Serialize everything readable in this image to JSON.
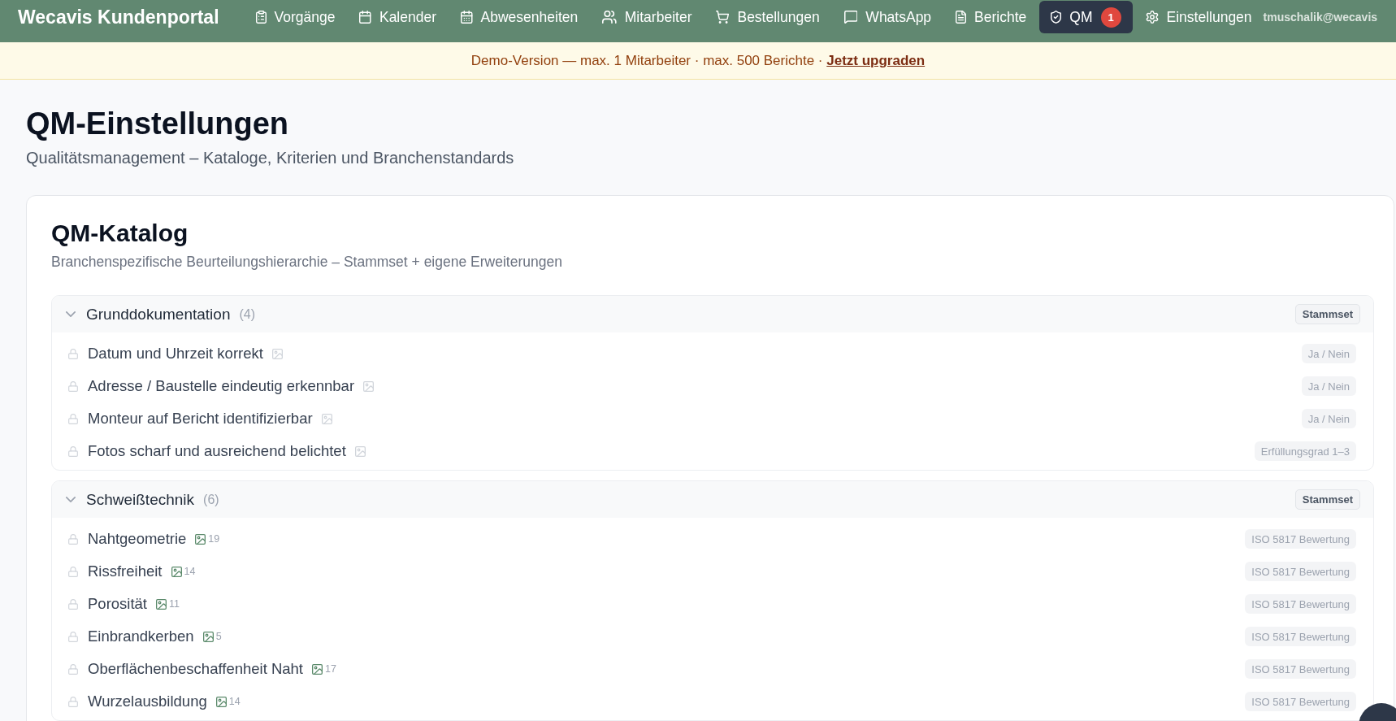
{
  "nav": {
    "brand": "Wecavis Kundenportal",
    "items": [
      {
        "label": "Vorgänge",
        "selected": false
      },
      {
        "label": "Kalender",
        "selected": false
      },
      {
        "label": "Abwesenheiten",
        "selected": false
      },
      {
        "label": "Mitarbeiter",
        "selected": false
      },
      {
        "label": "Bestellungen",
        "selected": false
      },
      {
        "label": "WhatsApp",
        "selected": false
      },
      {
        "label": "Berichte",
        "selected": false
      },
      {
        "label": "QM",
        "selected": true,
        "badge": "1"
      },
      {
        "label": "Einstellungen",
        "selected": false
      }
    ],
    "user": "tmuschalik@wecavis"
  },
  "banner": {
    "text": "Demo-Version — max. 1 Mitarbeiter · max. 500 Berichte ·",
    "link": "Jetzt upgraden"
  },
  "page": {
    "title": "QM-Einstellungen",
    "subtitle": "Qualitätsmanagement – Kataloge, Kriterien und Branchenstandards"
  },
  "catalog": {
    "title": "QM-Katalog",
    "subtitle": "Branchenspezifische Beurteilungshierarchie – Stammset + eigene Erweiterungen",
    "sections": [
      {
        "title": "Grunddokumentation",
        "count": "(4)",
        "expanded": true,
        "badge": "Stammset",
        "criteria": [
          {
            "label": "Datum und Uhrzeit korrekt",
            "locked": true,
            "rating_type": "Ja / Nein"
          },
          {
            "label": "Adresse / Baustelle eindeutig erkennbar",
            "locked": true,
            "rating_type": "Ja / Nein"
          },
          {
            "label": "Monteur auf Bericht identifizierbar",
            "locked": true,
            "rating_type": "Ja / Nein"
          },
          {
            "label": "Fotos scharf und ausreichend belichtet",
            "locked": true,
            "rating_type": "Erfüllungsgrad 1–3"
          }
        ]
      },
      {
        "title": "Schweißtechnik",
        "count": "(6)",
        "expanded": true,
        "badge": "Stammset",
        "criteria": [
          {
            "label": "Nahtgeometrie",
            "locked": true,
            "images": "19",
            "rating_type": "ISO 5817 Bewertung"
          },
          {
            "label": "Rissfreiheit",
            "locked": true,
            "images": "14",
            "rating_type": "ISO 5817 Bewertung"
          },
          {
            "label": "Porosität",
            "locked": true,
            "images": "11",
            "rating_type": "ISO 5817 Bewertung"
          },
          {
            "label": "Einbrandkerben",
            "locked": true,
            "images": "5",
            "rating_type": "ISO 5817 Bewertung"
          },
          {
            "label": "Oberflächenbeschaffenheit Naht",
            "locked": true,
            "images": "17",
            "rating_type": "ISO 5817 Bewertung"
          },
          {
            "label": "Wurzelausbildung",
            "locked": true,
            "images": "14",
            "rating_type": "ISO 5817 Bewertung"
          }
        ]
      }
    ]
  }
}
